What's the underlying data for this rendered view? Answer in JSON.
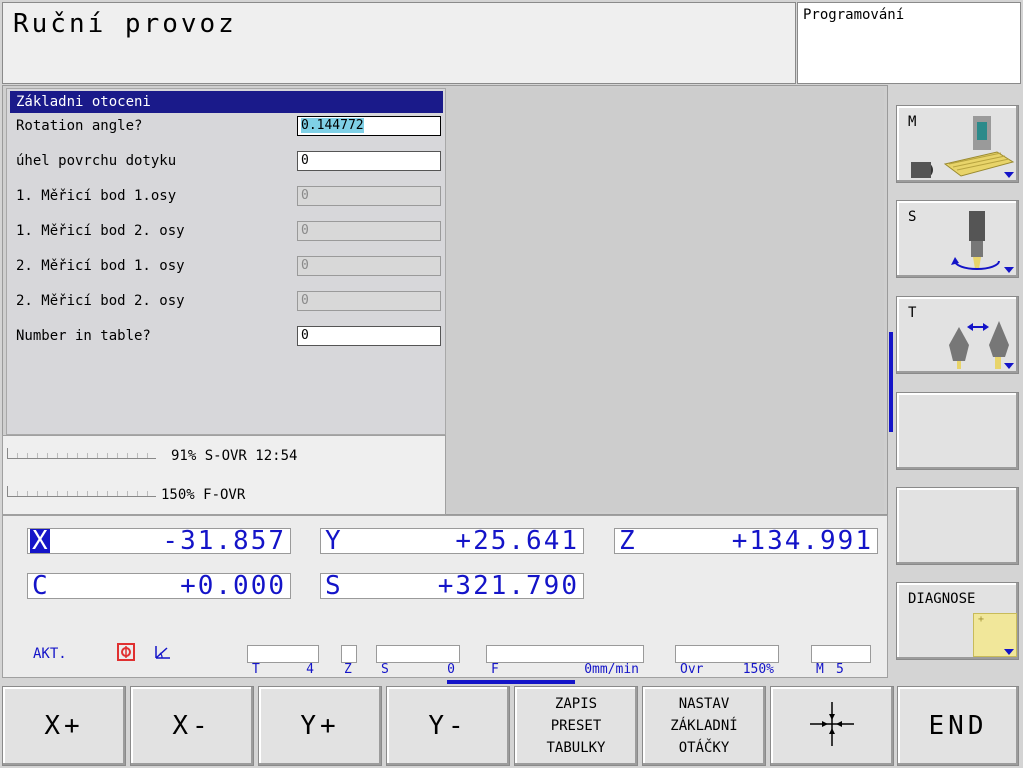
{
  "header": {
    "mode_title": "Ruční provoz",
    "secondary_mode": "Programování"
  },
  "dialog": {
    "title": "Základni otoceni",
    "fields": [
      {
        "label": "Rotation angle?",
        "value": "0.144772",
        "state": "focused"
      },
      {
        "label": "úhel povrchu dotyku",
        "value": "0",
        "state": "enabled"
      },
      {
        "label": "1. Měřicí bod 1.osy",
        "value": "0",
        "state": "disabled"
      },
      {
        "label": "1. Měřicí bod 2. osy",
        "value": "0",
        "state": "disabled"
      },
      {
        "label": "2. Měřicí bod 1. osy",
        "value": "0",
        "state": "disabled"
      },
      {
        "label": "2. Měřicí bod 2. osy",
        "value": "0",
        "state": "disabled"
      },
      {
        "label": "Number in table?",
        "value": "0",
        "state": "enabled"
      }
    ]
  },
  "overrides": {
    "s_ovr": "91% S-OVR 12:54",
    "f_ovr": "150% F-OVR",
    "s_ovr_level": 0.91,
    "f_ovr_level": 1.0
  },
  "positions": {
    "axes": [
      {
        "name": "X",
        "value": "-31.857",
        "highlight": true
      },
      {
        "name": "Y",
        "value": "+25.641",
        "highlight": false
      },
      {
        "name": "Z",
        "value": "+134.991",
        "highlight": false
      },
      {
        "name": "C",
        "value": "+0.000",
        "highlight": false
      },
      {
        "name": "S",
        "value": "+321.790",
        "highlight": false
      }
    ],
    "status_row": {
      "akt": "AKT.",
      "t_label": "T",
      "t_value": "4",
      "z_label": "Z",
      "s_label": "S",
      "s_value": "0",
      "f_label": "F",
      "f_value": "0mm/min",
      "ovr_label": "Ovr",
      "ovr_value": "150%",
      "m_label": "M",
      "m_value": "5"
    }
  },
  "side_softkeys": [
    {
      "label": "M",
      "icon": "machine-table-icon"
    },
    {
      "label": "S",
      "icon": "spindle-rotation-icon"
    },
    {
      "label": "T",
      "icon": "tool-change-icon"
    },
    {
      "label": ""
    },
    {
      "label": ""
    },
    {
      "label": "DIAGNOSE",
      "icon": "diagnose-note-icon"
    }
  ],
  "bottom_softkeys": [
    {
      "label": "X+"
    },
    {
      "label": "X-"
    },
    {
      "label": "Y+"
    },
    {
      "label": "Y-"
    },
    {
      "label": "ZAPIS\nPRESET\nTABULKY"
    },
    {
      "label": "NASTAV\nZÁKLADNÍ\nOTÁČKY"
    },
    {
      "label": "",
      "icon": "crosshair-icon"
    },
    {
      "label": "END"
    }
  ],
  "colors": {
    "accent_blue": "#1414c8",
    "header_blue": "#1a1a8a",
    "selection_cyan": "#7fd0e6",
    "warning_red": "#e03030"
  }
}
